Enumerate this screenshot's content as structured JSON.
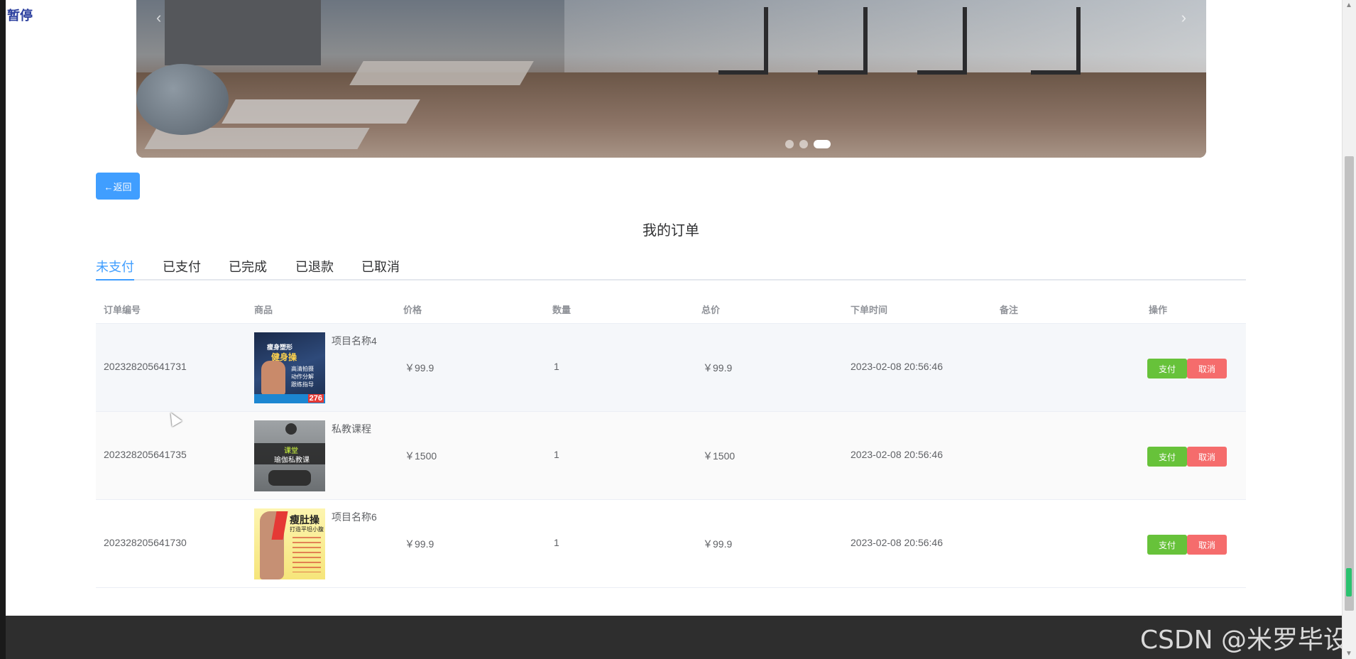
{
  "overlay": {
    "pause_label": "暂停"
  },
  "banner": {
    "prev_arrow": "‹",
    "next_arrow": "›",
    "slides": 3,
    "active_slide": 3
  },
  "back_button": {
    "label": "←返回"
  },
  "page": {
    "title": "我的订单"
  },
  "tabs": [
    {
      "label": "未支付",
      "active": true
    },
    {
      "label": "已支付",
      "active": false
    },
    {
      "label": "已完成",
      "active": false
    },
    {
      "label": "已退款",
      "active": false
    },
    {
      "label": "已取消",
      "active": false
    }
  ],
  "table": {
    "headers": [
      "订单编号",
      "商品",
      "价格",
      "数量",
      "总价",
      "下单时间",
      "备注",
      "操作"
    ],
    "rows": [
      {
        "order_no": "202328205641731",
        "product_name": "项目名称4",
        "image_text": {
          "a": "瘦身塑形",
          "b": "健身操",
          "c": "高清拍摄\n动作分解\n跟练指导",
          "d": "276"
        },
        "price": "￥99.9",
        "quantity": "1",
        "total": "￥99.9",
        "time": "2023-02-08 20:56:46",
        "note": "",
        "pay_label": "支付",
        "cancel_label": "取消"
      },
      {
        "order_no": "202328205641735",
        "product_name": "私教课程",
        "image_text": {
          "a": "课堂",
          "b": "瑜伽私教课"
        },
        "price": "￥1500",
        "quantity": "1",
        "total": "￥1500",
        "time": "2023-02-08 20:56:46",
        "note": "",
        "pay_label": "支付",
        "cancel_label": "取消"
      },
      {
        "order_no": "202328205641730",
        "product_name": "项目名称6",
        "image_text": {
          "a": "瘦肚操",
          "b": "打造平坦小腹"
        },
        "price": "￥99.9",
        "quantity": "1",
        "total": "￥99.9",
        "time": "2023-02-08 20:56:46",
        "note": "",
        "pay_label": "支付",
        "cancel_label": "取消"
      }
    ]
  },
  "watermark": {
    "text": "CSDN @米罗毕设"
  },
  "scrollbar": {
    "up": "▲",
    "down": "▼"
  },
  "colors": {
    "primary": "#409eff",
    "pay": "#67c23a",
    "cancel": "#f56c6c",
    "footer": "#2e2e2e"
  }
}
